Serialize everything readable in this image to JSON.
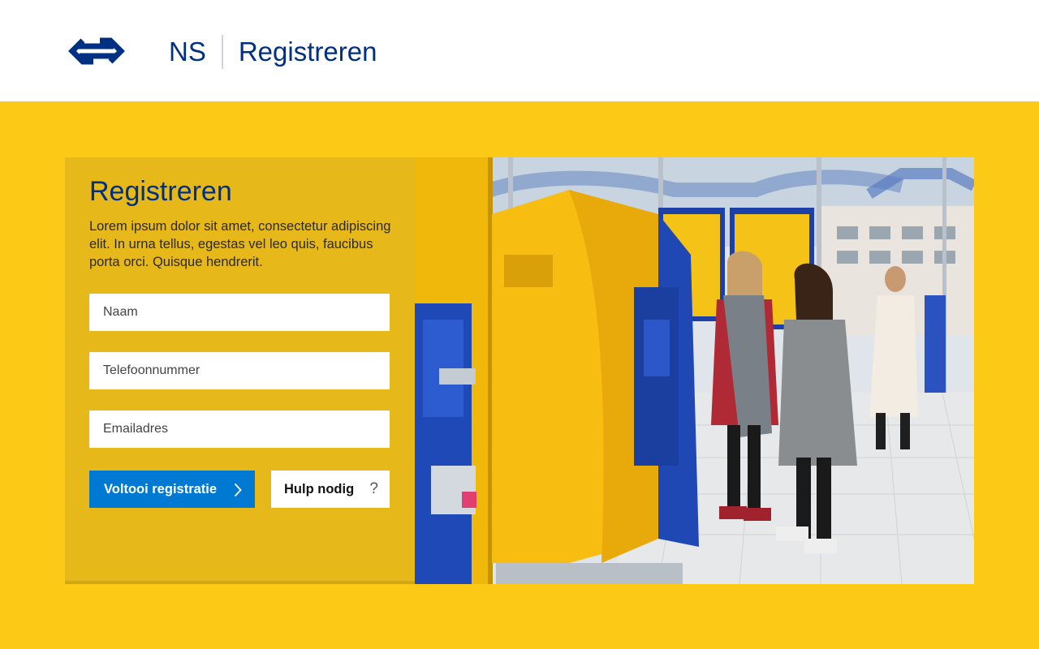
{
  "header": {
    "brand": "NS",
    "title": "Registreren",
    "logo_icon": "ns-logo-icon",
    "colors": {
      "navy": "#003082"
    }
  },
  "form": {
    "heading": "Registreren",
    "description": "Lorem ipsum dolor sit amet, consectetur adipiscing elit. In urna tellus, egestas vel leo quis, faucibus porta orci. Quisque hendrerit.",
    "fields": [
      {
        "placeholder": "Naam",
        "value": ""
      },
      {
        "placeholder": "Telefoonnummer",
        "value": ""
      },
      {
        "placeholder": "Emailadres",
        "value": ""
      }
    ],
    "submit_label": "Voltooi registratie",
    "help_label": "Hulp nodig",
    "help_icon": "?"
  },
  "colors": {
    "yellow": "#fcc917",
    "card": "#e6b81a",
    "primary_button": "#0079d3"
  }
}
